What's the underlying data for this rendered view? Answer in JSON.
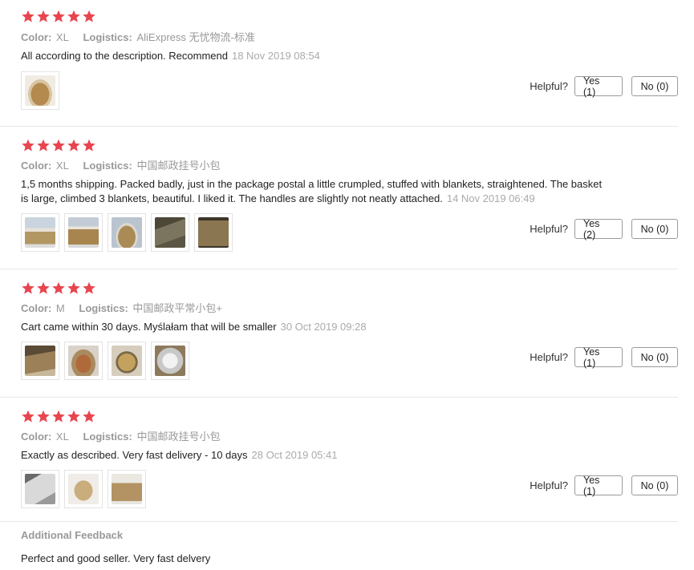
{
  "colors": {
    "star": "#e8454f",
    "meta": "#999999",
    "date": "#aaaaaa"
  },
  "labels": {
    "color_key": "Color:",
    "logistics_key": "Logistics:",
    "helpful": "Helpful?"
  },
  "reviews": [
    {
      "rating": 5,
      "color": "XL",
      "logistics": "AliExpress 无忧物流-标准",
      "text": "All according to the description. Recommend",
      "date": "18 Nov 2019 08:54",
      "photos": [
        "basket-photo"
      ],
      "yes": "Yes (1)",
      "no": "No (0)"
    },
    {
      "rating": 5,
      "color": "XL",
      "logistics": "中国邮政挂号小包",
      "text": "1,5 months shipping. Packed badly, just in the package postal a little crumpled, stuffed with blankets, straightened. The basket is large, climbed 3 blankets, beautiful. I liked it. The handles are slightly not neatly attached.",
      "date": "14 Nov 2019 06:49",
      "photos": [
        "basket-photo",
        "basket-photo",
        "basket-photo",
        "basket-photo",
        "basket-photo"
      ],
      "yes": "Yes (2)",
      "no": "No (0)"
    },
    {
      "rating": 5,
      "color": "M",
      "logistics": "中国邮政平常小包+",
      "text": "Cart came within 30 days. Myślałam that will be smaller",
      "date": "30 Oct 2019 09:28",
      "photos": [
        "basket-photo",
        "basket-photo",
        "basket-photo",
        "basket-photo"
      ],
      "yes": "Yes (1)",
      "no": "No (0)"
    },
    {
      "rating": 5,
      "color": "XL",
      "logistics": "中国邮政挂号小包",
      "text": "Exactly as described. Very fast delivery - 10 days",
      "date": "28 Oct 2019 05:41",
      "photos": [
        "basket-photo",
        "basket-photo",
        "basket-photo"
      ],
      "yes": "Yes (1)",
      "no": "No (0)"
    }
  ],
  "additional": {
    "title": "Additional Feedback",
    "text": "Perfect and good seller. Very fast delvery"
  }
}
